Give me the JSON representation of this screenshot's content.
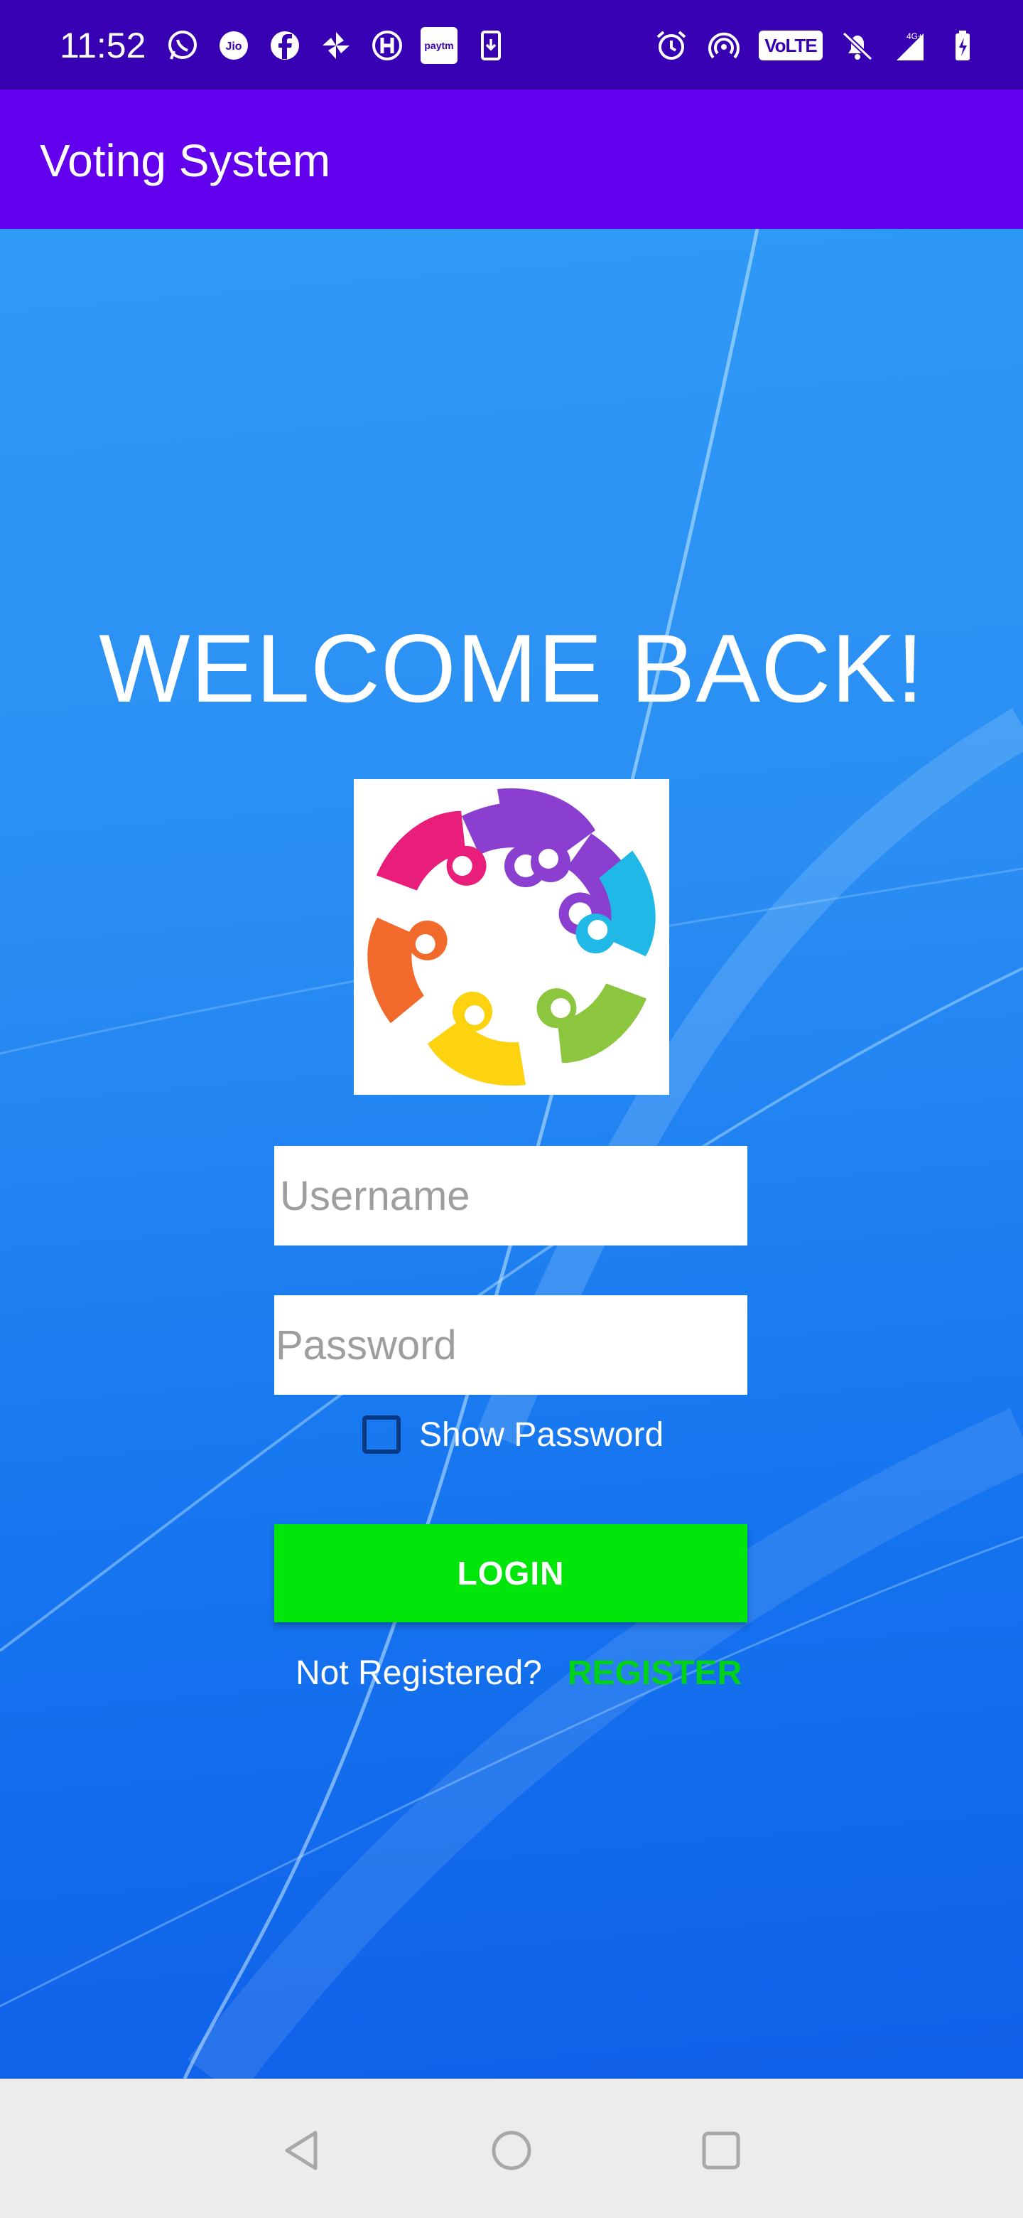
{
  "status_bar": {
    "time": "11:52",
    "left_icons": [
      "whatsapp-icon",
      "jio-icon",
      "facebook-icon",
      "pinwheel-icon",
      "hotstar-icon",
      "paytm-icon",
      "download-icon"
    ],
    "paytm_label": "paytm",
    "volte_label": "VoLTE",
    "network_label": "4G+",
    "right_icons": [
      "alarm-icon",
      "hotspot-icon",
      "volte-icon",
      "mute-icon",
      "signal-icon",
      "battery-icon"
    ]
  },
  "app_bar": {
    "title": "Voting System"
  },
  "main": {
    "welcome": "WELCOME BACK!",
    "username_placeholder": "Username",
    "password_placeholder": "Password",
    "show_password_label": "Show Password",
    "login_label": "LOGIN",
    "not_registered": "Not Registered?",
    "register_label": "REGISTER"
  },
  "nav_bar": {
    "buttons": [
      "back-icon",
      "home-icon",
      "recents-icon"
    ]
  },
  "colors": {
    "status_bar": "#3700b3",
    "app_bar": "#6200ee",
    "login_button": "#00e60a",
    "register_link": "#00d21a",
    "logo_segments": [
      "#e91e7a",
      "#8a3fd1",
      "#20b8e6",
      "#8cc63f",
      "#fdd20e",
      "#f26a2b"
    ]
  }
}
